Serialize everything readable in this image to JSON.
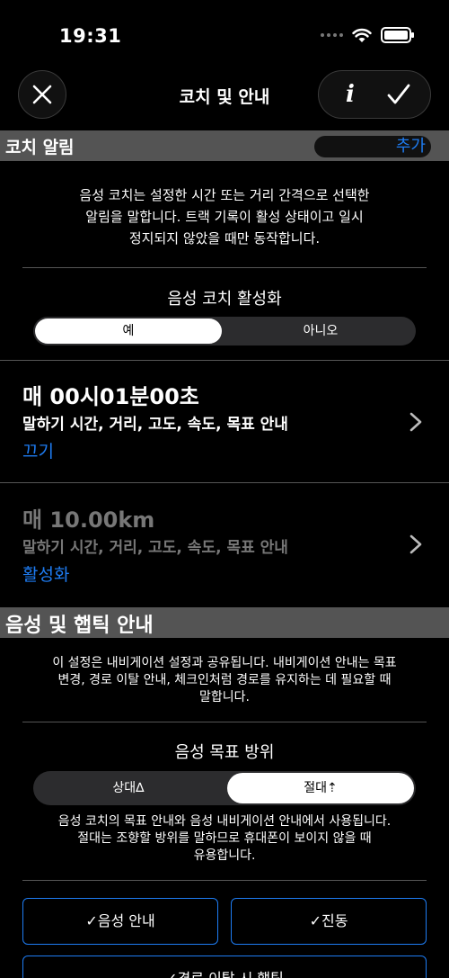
{
  "status": {
    "time": "19:31"
  },
  "nav": {
    "title": "코치 및 안내",
    "info_label": "i"
  },
  "coach_alerts": {
    "header": "코치 알림",
    "add_label": "추가",
    "description": [
      "음성 코치는 설정한 시간 또는 거리 간격으로 선택한",
      "알림을 말합니다. 트랙 기록이 활성 상태이고 일시",
      "정지되지 않았을 때만 동작합니다."
    ],
    "enable_label": "음성 코치 활성화",
    "options": [
      "예",
      "아니오"
    ],
    "selected": 0,
    "items": [
      {
        "title": "매 00시01분00초",
        "subtitle": "말하기 시간, 거리, 고도, 속도, 목표 안내",
        "action": "끄기",
        "enabled": true
      },
      {
        "title": "매 10.00km",
        "subtitle": "말하기 시간, 거리, 고도, 속도, 목표 안내",
        "action": "활성화",
        "enabled": false
      }
    ]
  },
  "voice_haptic": {
    "header": "음성 및 햅틱 안내",
    "description": [
      "이 설정은 내비게이션 설정과 공유됩니다. 내비게이션 안내는 목표",
      "변경, 경로 이탈 안내, 체크인처럼 경로를 유지하는 데 필요할 때",
      "말합니다."
    ],
    "bearing_label": "음성 목표 방위",
    "bearing_options": [
      "상대∆",
      "절대⇡"
    ],
    "bearing_selected": 1,
    "bearing_note": [
      "음성 코치의 목표 안내와 음성 내비게이션 안내에서 사용됩니다.",
      "절대는 조향할 방위를 말하므로 휴대폰이 보이지 않을 때",
      "유용합니다."
    ],
    "toggles": [
      "✓음성 안내",
      "✓진동",
      "✓경로 이탈 시 햅틱"
    ]
  }
}
